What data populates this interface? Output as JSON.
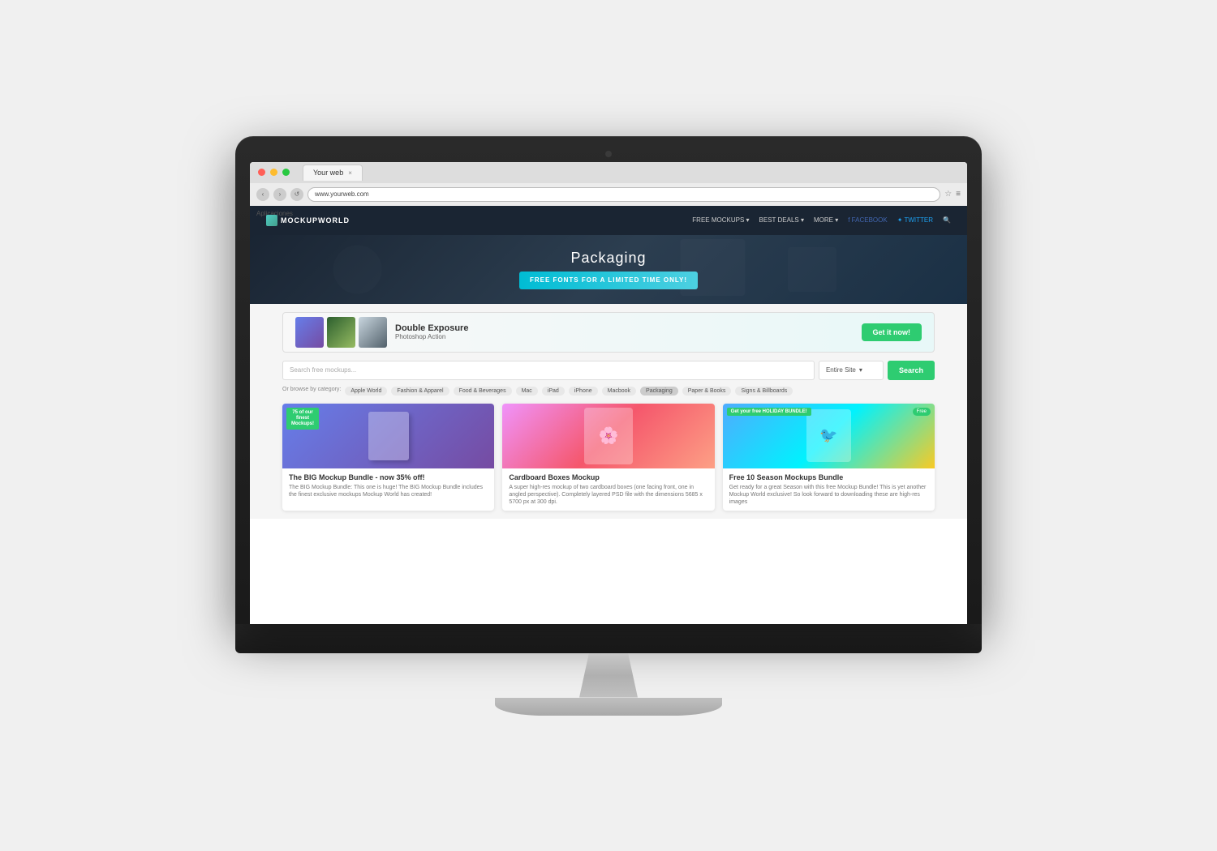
{
  "imac": {
    "apple_logo": ""
  },
  "browser": {
    "tab_title": "Your web",
    "address": "www.yourweb.com",
    "bookmarks_label": "Aplicaciones"
  },
  "site": {
    "nav": {
      "logo": "MOCKUPWORLD",
      "links": [
        "FREE MOCKUPS ▾",
        "BEST DEALS ▾",
        "MORE ▾",
        "f FACEBOOK",
        "✦ TWITTER",
        "🔍"
      ]
    },
    "hero": {
      "title": "Packaging",
      "banner_text": "FREE FONTS FOR A LIMITED TIME ONLY!"
    },
    "ad": {
      "title": "Double Exposure",
      "subtitle": "Photoshop Action",
      "cta": "Get it now!"
    },
    "search": {
      "placeholder": "Search free mockups...",
      "filter": "Entire Site",
      "button": "Search"
    },
    "categories": {
      "label": "Or browse by category:",
      "items": [
        "Apple World",
        "Fashion & Apparel",
        "Food & Beverages",
        "Mac",
        "iPad",
        "iPhone",
        "Macbook",
        "Packaging",
        "Paper & Books",
        "Signs & Billboards"
      ]
    },
    "cards": [
      {
        "title": "The BIG Mockup Bundle - now 35% off!",
        "badge": "75 of our finest Mockups!",
        "desc": "The BIG Mockup Bundle: This one is huge! The BIG Mockup Bundle includes the finest exclusive mockups Mockup World has created!",
        "type": "paid"
      },
      {
        "title": "Cardboard Boxes Mockup",
        "badge": "",
        "desc": "A super high-res mockup of two cardboard boxes (one facing front, one in angled perspective). Completely layered PSD file with the dimensions 5685 x 5700 px at 300 dpi.",
        "type": "free"
      },
      {
        "title": "Free 10 Season Mockups Bundle",
        "badge": "Get your free HOLIDAY BUNDLE!",
        "badge2": "Free",
        "desc": "Get ready for a great Season with this free Mockup Bundle! This is yet another Mockup World exclusive! So look forward to downloading these are high-res images",
        "type": "free"
      }
    ]
  }
}
